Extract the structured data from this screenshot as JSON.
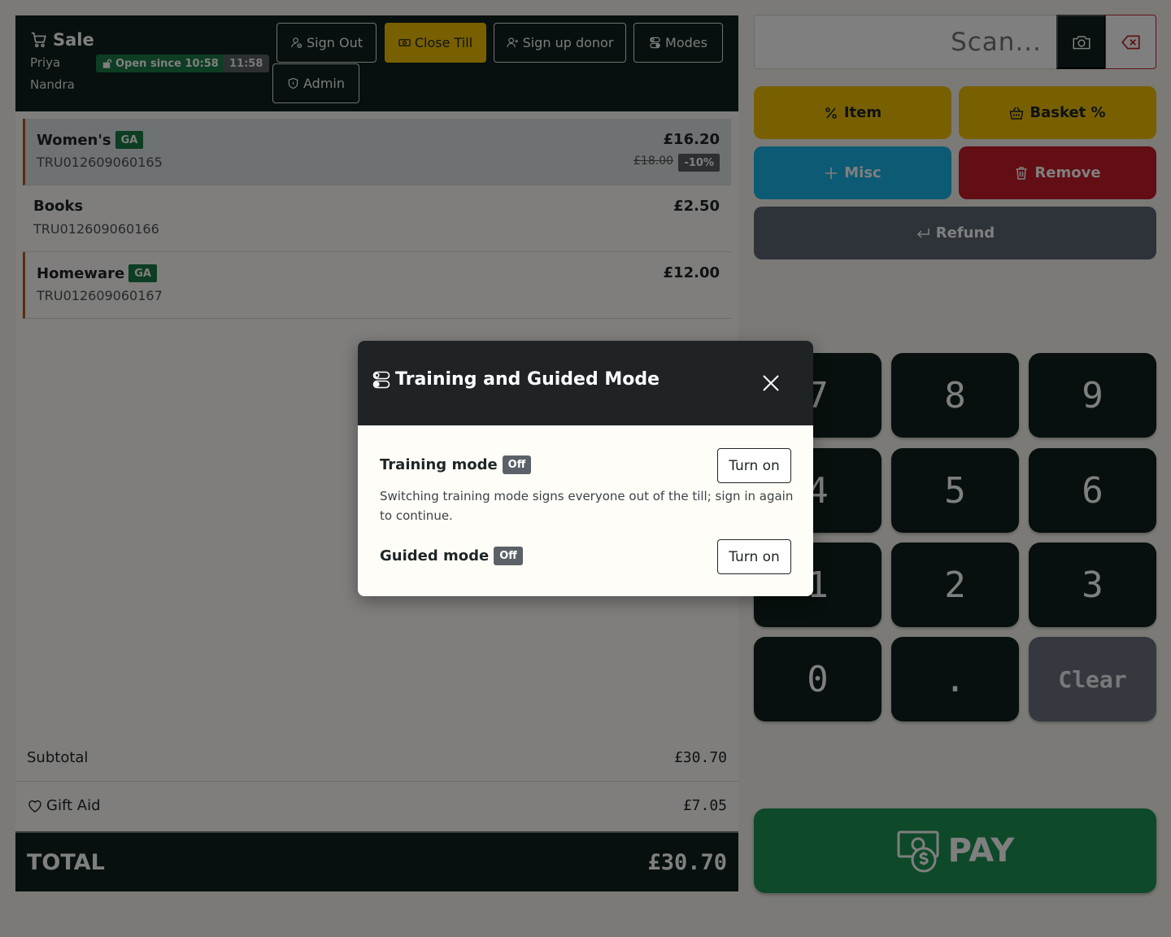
{
  "header": {
    "title": "Sale",
    "user_first": "Priya",
    "user_last": "Nandra",
    "open_badge": "Open since 10:58",
    "time": "11:58",
    "buttons": {
      "sign_out": "Sign Out",
      "close_till": "Close Till",
      "sign_up_donor": "Sign up donor",
      "modes": "Modes",
      "admin": "Admin"
    }
  },
  "basket": {
    "items": [
      {
        "name": "Women's",
        "tag": "GA",
        "sku": "TRU012609060165",
        "price": "£16.20",
        "was_price": "£18.00",
        "discount": "-10%"
      },
      {
        "name": "Books",
        "sku": "TRU012609060166",
        "price": "£2.50"
      },
      {
        "name": "Homeware",
        "tag": "GA",
        "sku": "TRU012609060167",
        "price": "£12.00"
      }
    ],
    "subtotal_label": "Subtotal",
    "subtotal_value": "£30.70",
    "gift_aid_label": "Gift Aid",
    "gift_aid_value": "£7.05",
    "total_label": "TOTAL",
    "total_value": "£30.70"
  },
  "scan": {
    "placeholder": "Scan..."
  },
  "actions": {
    "item_discount": "Item",
    "basket_discount": "Basket %",
    "misc": "Misc",
    "remove": "Remove",
    "refund": "Refund"
  },
  "keypad": {
    "keys": [
      "7",
      "8",
      "9",
      "4",
      "5",
      "6",
      "1",
      "2",
      "3",
      "0",
      ".",
      "Clear"
    ]
  },
  "pay_label": "PAY",
  "modal": {
    "title": "Training and Guided Mode",
    "training_label": "Training mode",
    "training_state": "Off",
    "training_button": "Turn on",
    "training_description": "Switching training mode signs everyone out of the till; sign in again to continue.",
    "guided_label": "Guided mode",
    "guided_state": "Off",
    "guided_button": "Turn on"
  },
  "colors": {
    "dark": "#0f201c",
    "yellow": "#f0c000",
    "blue": "#18b4e6",
    "red": "#c41d28",
    "green": "#1d9352",
    "grey": "#5d6672",
    "ga_green": "#1b7a45"
  }
}
